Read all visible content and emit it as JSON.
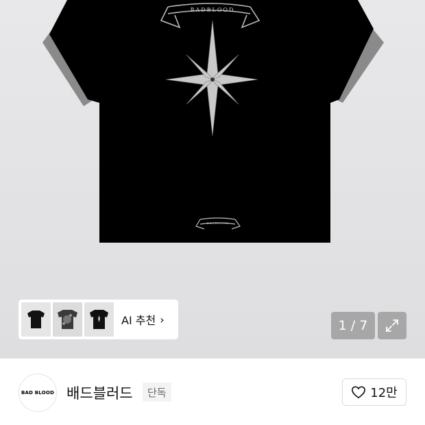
{
  "hero": {
    "tshirt_front_text": "BADBLOOD",
    "tshirt_hem_text": "BADBLOOD"
  },
  "ai_recommend": {
    "label": "AI 추천",
    "chevron": "›",
    "thumbnails": [
      "tshirt-thumbnail-1",
      "tshirt-thumbnail-2",
      "tshirt-thumbnail-3"
    ]
  },
  "gallery": {
    "counter": "1 / 7",
    "expand_icon": "expand-icon"
  },
  "brand": {
    "logo_text": "BAD BLOOD",
    "name": "배드블러드",
    "badge": "단독",
    "likes": "12만",
    "like_icon": "heart-icon"
  }
}
